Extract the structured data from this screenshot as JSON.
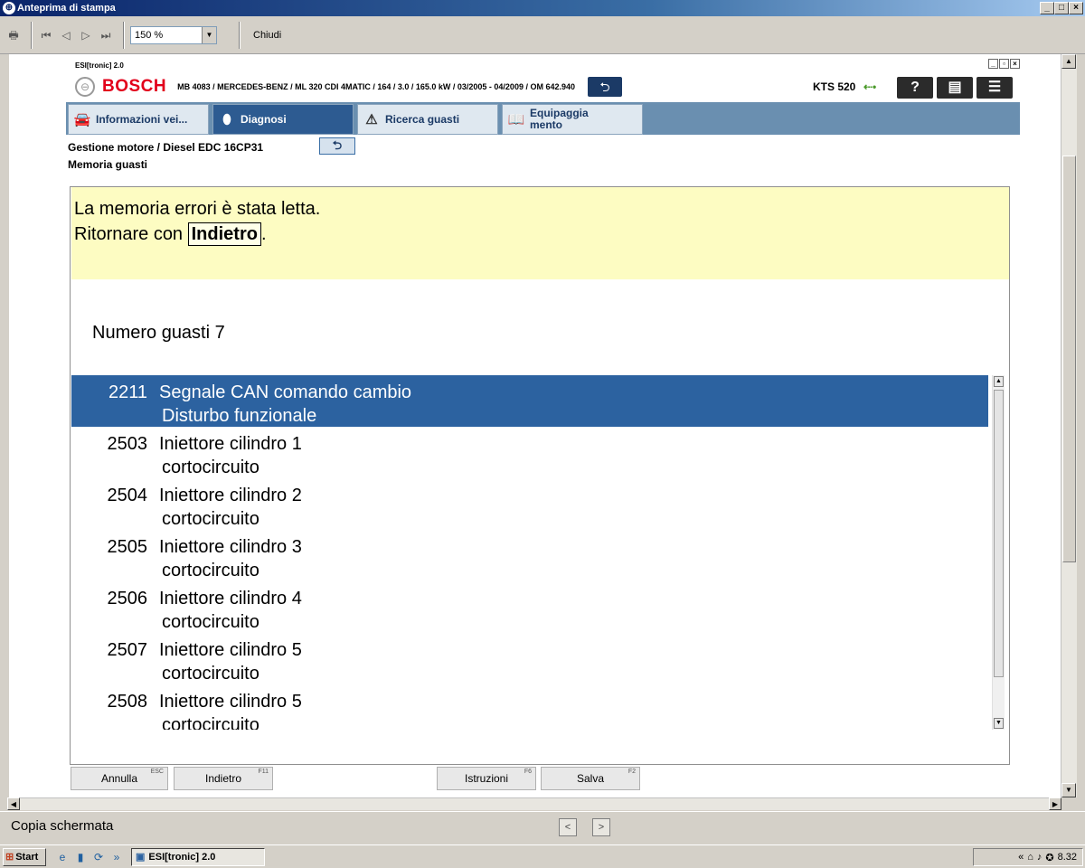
{
  "outer_window": {
    "title": "Anteprima di stampa",
    "zoom": "150 %",
    "close_label": "Chiudi"
  },
  "esi": {
    "title": "ESI[tronic] 2.0",
    "brand": "BOSCH",
    "vehicle": "MB 4083 / MERCEDES-BENZ / ML 320 CDI 4MATIC / 164 / 3.0 / 165.0 kW / 03/2005 - 04/2009 / OM 642.940",
    "device": "KTS 520",
    "tabs": [
      {
        "label": "Informazioni vei...",
        "icon": "car-icon"
      },
      {
        "label": "Diagnosi",
        "icon": "diagnosis-icon"
      },
      {
        "label": "Ricerca guasti",
        "icon": "troubleshoot-icon"
      },
      {
        "label": "Equipaggia\nmento",
        "icon": "book-icon"
      }
    ],
    "breadcrumb": "Gestione motore / Diesel EDC 16CP31",
    "section": "Memoria guasti",
    "message": {
      "line1": "La memoria errori è stata letta.",
      "line2_prefix": "Ritornare con",
      "line2_key": "Indietro",
      "line2_suffix": "."
    },
    "fault_count": "Numero guasti 7",
    "faults": [
      {
        "code": "2211",
        "desc": "Segnale CAN comando cambio",
        "status": "Disturbo funzionale"
      },
      {
        "code": "2503",
        "desc": "Iniettore cilindro 1",
        "status": "cortocircuito"
      },
      {
        "code": "2504",
        "desc": "Iniettore cilindro 2",
        "status": "cortocircuito"
      },
      {
        "code": "2505",
        "desc": "Iniettore cilindro 3",
        "status": "cortocircuito"
      },
      {
        "code": "2506",
        "desc": "Iniettore cilindro 4",
        "status": "cortocircuito"
      },
      {
        "code": "2507",
        "desc": "Iniettore cilindro 5",
        "status": "cortocircuito"
      },
      {
        "code": "2508",
        "desc": "Iniettore cilindro 5",
        "status": "cortocircuito"
      }
    ],
    "buttons": {
      "annulla": {
        "label": "Annulla",
        "key": "ESC"
      },
      "indietro": {
        "label": "Indietro",
        "key": "F11"
      },
      "istruzioni": {
        "label": "Istruzioni",
        "key": "F6"
      },
      "salva": {
        "label": "Salva",
        "key": "F2"
      }
    }
  },
  "statusbar": {
    "text": "Copia schermata"
  },
  "taskbar": {
    "start": "Start",
    "task": "ESI[tronic] 2.0",
    "clock": "8.32"
  },
  "colors": {
    "selected_row": "#2c62a0",
    "message_bg": "#fdfcc2",
    "bosch_red": "#e2001a",
    "tab_active": "#2d5b91"
  }
}
